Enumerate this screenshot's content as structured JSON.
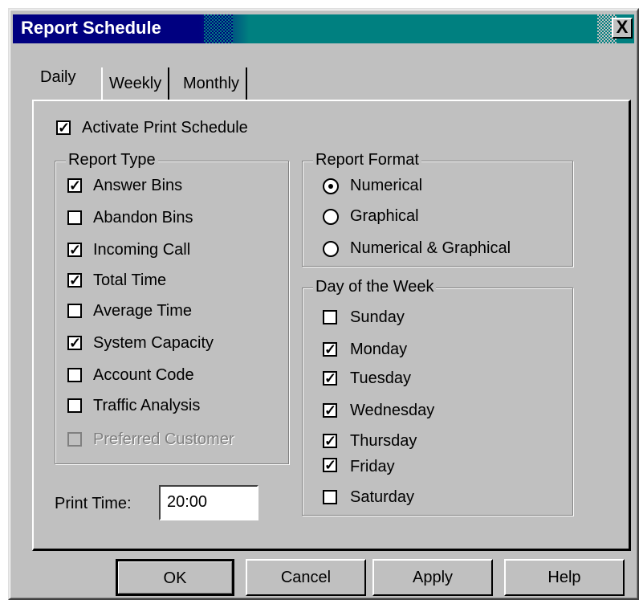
{
  "window": {
    "title": "Report Schedule",
    "close_label": "X"
  },
  "tabs": [
    {
      "label": "Daily",
      "active": true
    },
    {
      "label": "Weekly",
      "active": false
    },
    {
      "label": "Monthly",
      "active": false
    }
  ],
  "activate": {
    "label": "Activate Print Schedule",
    "checked": true
  },
  "report_type": {
    "legend": "Report Type",
    "items": [
      {
        "label": "Answer Bins",
        "checked": true,
        "enabled": true
      },
      {
        "label": "Abandon Bins",
        "checked": false,
        "enabled": true
      },
      {
        "label": "Incoming Call",
        "checked": true,
        "enabled": true
      },
      {
        "label": "Total Time",
        "checked": true,
        "enabled": true
      },
      {
        "label": "Average Time",
        "checked": false,
        "enabled": true
      },
      {
        "label": "System Capacity",
        "checked": true,
        "enabled": true
      },
      {
        "label": "Account Code",
        "checked": false,
        "enabled": true
      },
      {
        "label": "Traffic Analysis",
        "checked": false,
        "enabled": true
      },
      {
        "label": "Preferred Customer",
        "checked": false,
        "enabled": false
      }
    ]
  },
  "report_format": {
    "legend": "Report Format",
    "options": [
      {
        "label": "Numerical",
        "selected": true
      },
      {
        "label": "Graphical",
        "selected": false
      },
      {
        "label": "Numerical & Graphical",
        "selected": false
      }
    ]
  },
  "day_of_week": {
    "legend": "Day of the Week",
    "items": [
      {
        "label": "Sunday",
        "checked": false
      },
      {
        "label": "Monday",
        "checked": true
      },
      {
        "label": "Tuesday",
        "checked": true
      },
      {
        "label": "Wednesday",
        "checked": true
      },
      {
        "label": "Thursday",
        "checked": true
      },
      {
        "label": "Friday",
        "checked": true
      },
      {
        "label": "Saturday",
        "checked": false
      }
    ]
  },
  "print_time": {
    "label": "Print Time:",
    "value": "20:00"
  },
  "buttons": {
    "ok": "OK",
    "cancel": "Cancel",
    "apply": "Apply",
    "help": "Help"
  },
  "colors": {
    "face": "#c0c0c0",
    "title_start": "#000080",
    "title_end": "#008080"
  }
}
